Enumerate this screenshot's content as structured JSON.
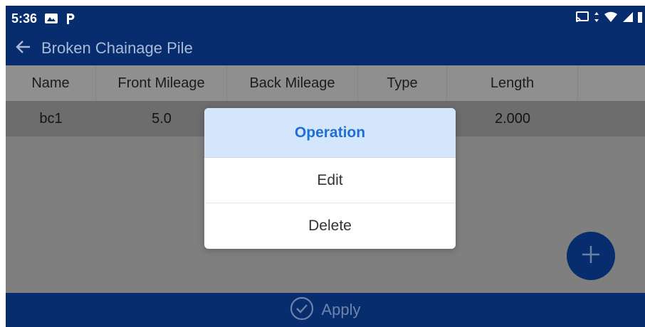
{
  "status_bar": {
    "time": "5:36",
    "left_icons": [
      "photos-icon",
      "parking-icon"
    ],
    "right_icons": [
      "cast-icon",
      "data-arrows-icon",
      "wifi-icon",
      "signal-icon",
      "battery-icon"
    ]
  },
  "app_bar": {
    "title": "Broken Chainage Pile",
    "back_icon": "back-arrow-icon"
  },
  "table": {
    "columns": [
      "Name",
      "Front Mileage",
      "Back Mileage",
      "Type",
      "Length"
    ],
    "rows": [
      [
        "bc1",
        "5.0",
        "",
        "",
        "2.000"
      ]
    ]
  },
  "dialog": {
    "title": "Operation",
    "items": [
      "Edit",
      "Delete"
    ]
  },
  "fab": {
    "icon": "plus-icon"
  },
  "bottom_bar": {
    "apply_label": "Apply",
    "apply_icon": "check-circle-icon"
  },
  "colors": {
    "primary": "#072d6e",
    "dialog_title_bg": "#d3e6fb",
    "dialog_title_text": "#1f6fd6"
  }
}
